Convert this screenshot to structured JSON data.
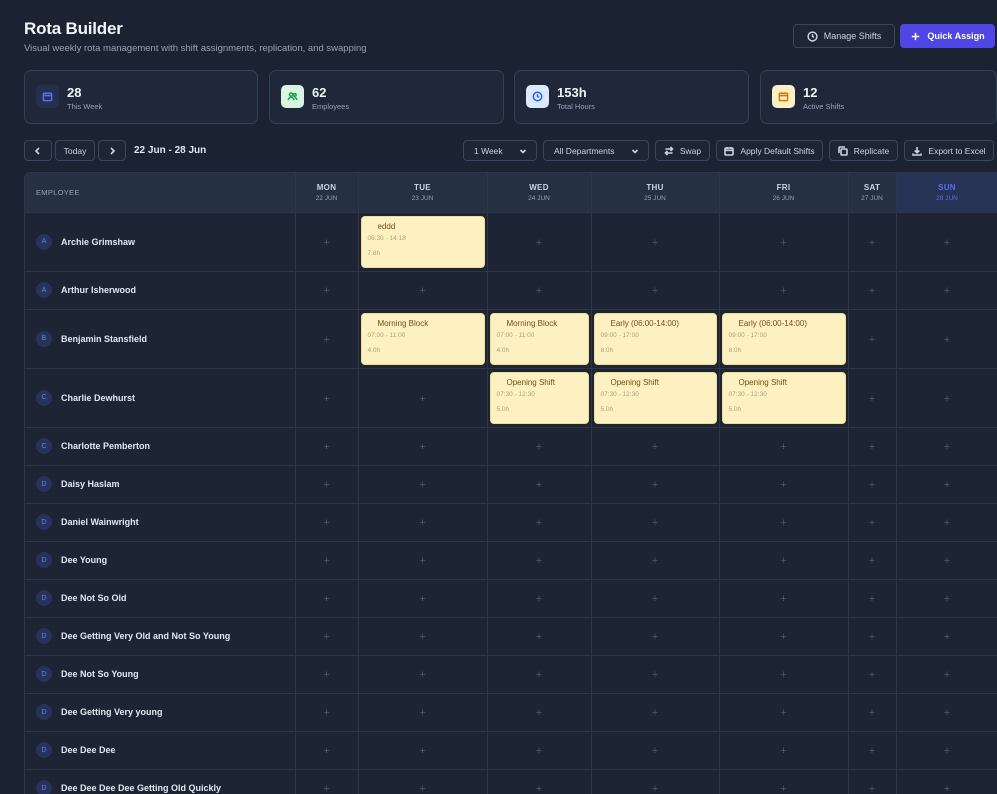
{
  "header": {
    "title": "Rota Builder",
    "subtitle": "Visual weekly rota management with shift assignments, replication, and swapping",
    "manage_shifts": "Manage Shifts",
    "quick_assign": "Quick Assign"
  },
  "stats": [
    {
      "value": "28",
      "label": "This Week",
      "icon": "calendar-icon",
      "color": "#6366f1"
    },
    {
      "value": "62",
      "label": "Employees",
      "icon": "users-icon",
      "color": "#22c55e"
    },
    {
      "value": "153h",
      "label": "Total Hours",
      "icon": "clock-icon",
      "color": "#3b82f6"
    },
    {
      "value": "12",
      "label": "Active Shifts",
      "icon": "calendar-icon",
      "color": "#f59e0b"
    }
  ],
  "toolbar": {
    "today": "Today",
    "date_range": "22 Jun - 28 Jun",
    "view_select": "1 Week",
    "department_select": "All Departments",
    "swap": "Swap",
    "apply_default": "Apply Default Shifts",
    "replicate": "Replicate",
    "export": "Export to Excel"
  },
  "grid": {
    "employee_header": "EMPLOYEE",
    "days": [
      {
        "name": "MON",
        "date": "22 JUN"
      },
      {
        "name": "TUE",
        "date": "23 JUN"
      },
      {
        "name": "WED",
        "date": "24 JUN"
      },
      {
        "name": "THU",
        "date": "25 JUN"
      },
      {
        "name": "FRI",
        "date": "26 JUN"
      },
      {
        "name": "SAT",
        "date": "27 JUN"
      },
      {
        "name": "SUN",
        "date": "28 JUN",
        "today": true
      }
    ],
    "rows": [
      {
        "initial": "A",
        "name": "Archie Grimshaw",
        "tall": true,
        "shifts": [
          null,
          {
            "name": "eddd",
            "time": "06:30 - 14:18",
            "hours": "7.8h"
          },
          null,
          null,
          null,
          null,
          null
        ]
      },
      {
        "initial": "A",
        "name": "Arthur Isherwood",
        "shifts": [
          null,
          null,
          null,
          null,
          null,
          null,
          null
        ]
      },
      {
        "initial": "B",
        "name": "Benjamin Stansfield",
        "tall": true,
        "shifts": [
          null,
          {
            "name": "Morning Block",
            "time": "07:00 - 11:00",
            "hours": "4.0h"
          },
          {
            "name": "Morning Block",
            "time": "07:00 - 11:00",
            "hours": "4.0h"
          },
          {
            "name": "Early (06:00-14:00)",
            "time": "09:00 - 17:00",
            "hours": "8.0h"
          },
          {
            "name": "Early (06:00-14:00)",
            "time": "09:00 - 17:00",
            "hours": "8.0h"
          },
          null,
          null
        ]
      },
      {
        "initial": "C",
        "name": "Charlie Dewhurst",
        "tall": true,
        "shifts": [
          null,
          null,
          {
            "name": "Opening Shift",
            "time": "07:30 - 12:30",
            "hours": "5.0h"
          },
          {
            "name": "Opening Shift",
            "time": "07:30 - 12:30",
            "hours": "5.0h"
          },
          {
            "name": "Opening Shift",
            "time": "07:30 - 12:30",
            "hours": "5.0h"
          },
          null,
          null
        ]
      },
      {
        "initial": "C",
        "name": "Charlotte Pemberton",
        "shifts": [
          null,
          null,
          null,
          null,
          null,
          null,
          null
        ]
      },
      {
        "initial": "D",
        "name": "Daisy Haslam",
        "shifts": [
          null,
          null,
          null,
          null,
          null,
          null,
          null
        ]
      },
      {
        "initial": "D",
        "name": "Daniel Wainwright",
        "shifts": [
          null,
          null,
          null,
          null,
          null,
          null,
          null
        ]
      },
      {
        "initial": "D",
        "name": "Dee Young",
        "shifts": [
          null,
          null,
          null,
          null,
          null,
          null,
          null
        ]
      },
      {
        "initial": "D",
        "name": "Dee Not So Old",
        "shifts": [
          null,
          null,
          null,
          null,
          null,
          null,
          null
        ]
      },
      {
        "initial": "D",
        "name": "Dee Getting Very Old and Not So Young",
        "shifts": [
          null,
          null,
          null,
          null,
          null,
          null,
          null
        ]
      },
      {
        "initial": "D",
        "name": "Dee Not So Young",
        "shifts": [
          null,
          null,
          null,
          null,
          null,
          null,
          null
        ]
      },
      {
        "initial": "D",
        "name": "Dee Getting Very young",
        "shifts": [
          null,
          null,
          null,
          null,
          null,
          null,
          null
        ]
      },
      {
        "initial": "D",
        "name": "Dee Dee Dee",
        "shifts": [
          null,
          null,
          null,
          null,
          null,
          null,
          null
        ]
      },
      {
        "initial": "D",
        "name": "Dee Dee Dee Dee Getting Old Quickly",
        "shifts": [
          null,
          null,
          null,
          null,
          null,
          null,
          null
        ]
      }
    ]
  }
}
